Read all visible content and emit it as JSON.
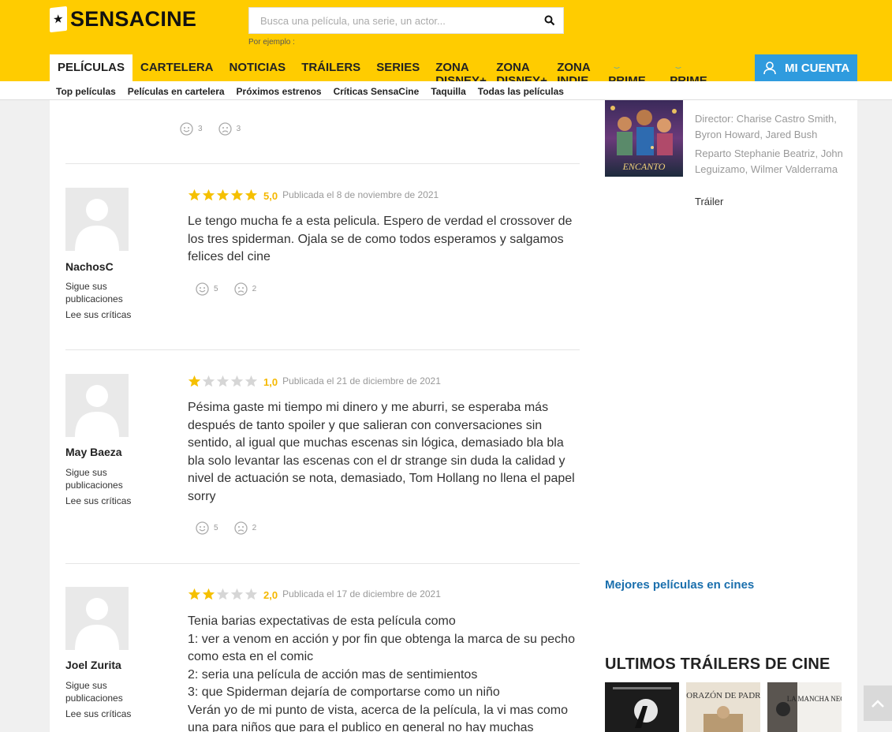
{
  "brand": {
    "name": "SENSACINE",
    "accent": "#ffcc00",
    "account_color": "#2f9bde"
  },
  "search": {
    "placeholder": "Busca una película, una serie, un actor...",
    "hint": "Por ejemplo :"
  },
  "nav": {
    "items": [
      "PELÍCULAS",
      "CARTELERA",
      "NOTICIAS",
      "TRÁILERS",
      "SERIES",
      "ZONA DISNEY+",
      "ZONA DISNEY+",
      "ZONA INDIE",
      "PRIME VIDEO",
      "PRIME VIDEO"
    ],
    "account": "MI CUENTA"
  },
  "subnav": [
    "Top películas",
    "Películas en cartelera",
    "Próximos estrenos",
    "Críticas SensaCine",
    "Taquilla",
    "Todas las películas"
  ],
  "reviews": [
    {
      "user": "",
      "votes_up": "3",
      "votes_down": "3"
    },
    {
      "user": "NachosC",
      "follow": "Sigue sus publicaciones",
      "read": "Lee sus críticas",
      "stars": 5,
      "score": "5,0",
      "date": "Publicada el 8 de noviembre de 2021",
      "text": "Le tengo mucha fe a esta pelicula. Espero de verdad el crossover de los tres spiderman. Ojala se de como todos esperamos y salgamos felices del cine",
      "votes_up": "5",
      "votes_down": "2"
    },
    {
      "user": "May Baeza",
      "follow": "Sigue sus publicaciones",
      "read": "Lee sus críticas",
      "stars": 1,
      "score": "1,0",
      "date": "Publicada el 21 de diciembre de 2021",
      "text": "Pésima gaste mi tiempo mi dinero y me aburri, se esperaba más después de tanto spoiler y que salieran con conversaciones sin sentido, al igual que muchas escenas sin lógica, demasiado bla bla bla solo levantar las escenas con el dr strange sin duda la calidad y nivel de actuación se nota, demasiado, Tom Hollang no llena el papel sorry",
      "votes_up": "5",
      "votes_down": "2"
    },
    {
      "user": "Joel Zurita",
      "follow": "Sigue sus publicaciones",
      "read": "Lee sus críticas",
      "stars": 2,
      "score": "2,0",
      "date": "Publicada el 17 de diciembre de 2021",
      "text": "Tenia barias expectativas de esta película como\n1: ver a venom en acción y por fin que obtenga la marca de su pecho como esta en el comic\n2: seria una película de acción mas de sentimientos\n3: que Spiderman dejaría de comportarse como un niño\nVerán yo de mi punto de vista, acerca de la película, la vi mas como una para niños que para el publico en general no hay muchas"
    }
  ],
  "sidebar": {
    "movie": {
      "poster_title": "ENCANTO",
      "director": "Director: Charise Castro Smith, Byron Howard, Jared Bush",
      "cast": "Reparto Stephanie Beatriz, John Leguizamo, Wilmer Valderrama",
      "trailer": "Tráiler"
    },
    "best_link": "Mejores películas en cines",
    "trailers_title": "ULTIMOS TRÁILERS DE CINE",
    "thumbs": [
      "",
      "CORAZÓN DE PADRE",
      "LA MANCHA NEGRA"
    ]
  }
}
